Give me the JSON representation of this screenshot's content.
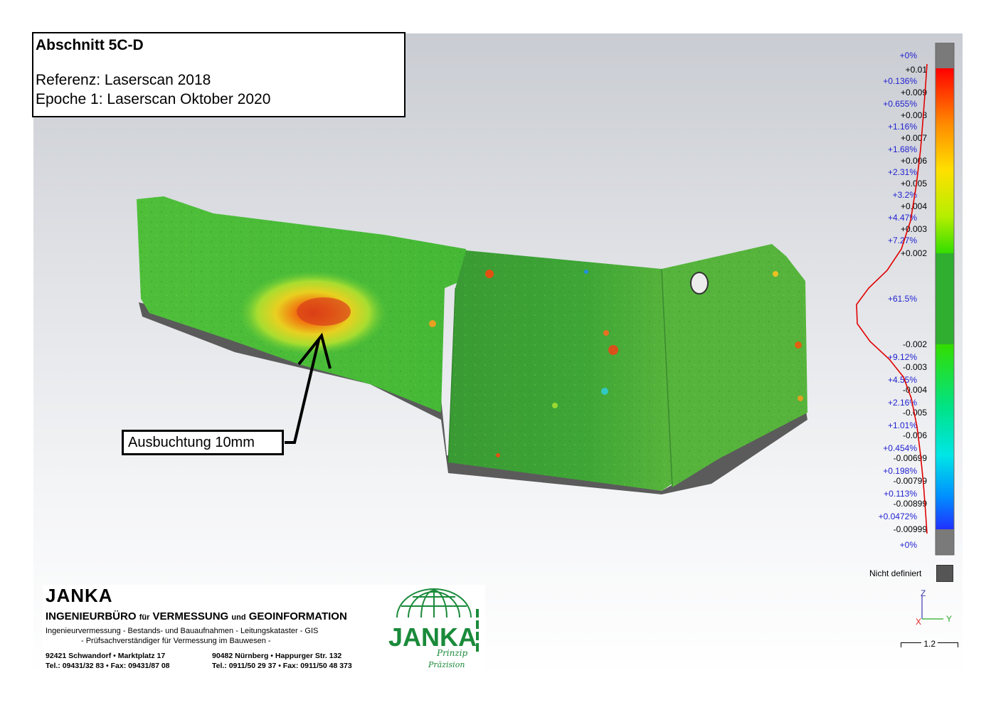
{
  "header": {
    "title": "Abschnitt 5C-D",
    "reference": "Referenz: Laserscan 2018",
    "epoch": "Epoche 1: Laserscan Oktober 2020"
  },
  "annotation": {
    "label": "Ausbuchtung 10mm"
  },
  "color_scale": {
    "entries": [
      {
        "pct": "+0%",
        "val": "+0.01"
      },
      {
        "pct": "+0.136%",
        "val": "+0.009"
      },
      {
        "pct": "+0.655%",
        "val": "+0.008"
      },
      {
        "pct": "+1.16%",
        "val": "+0.007"
      },
      {
        "pct": "+1.68%",
        "val": "+0.006"
      },
      {
        "pct": "+2.31%",
        "val": "+0.005"
      },
      {
        "pct": "+3.2%",
        "val": "+0.004"
      },
      {
        "pct": "+4.47%",
        "val": "+0.003"
      },
      {
        "pct": "+7.27%",
        "val": "+0.002"
      },
      {
        "pct": "+61.5%",
        "val": "-0.002"
      },
      {
        "pct": "+9.12%",
        "val": "-0.003"
      },
      {
        "pct": "+4.55%",
        "val": "-0.004"
      },
      {
        "pct": "+2.16%",
        "val": "-0.005"
      },
      {
        "pct": "+1.01%",
        "val": "-0.006"
      },
      {
        "pct": "+0.454%",
        "val": "-0.00699"
      },
      {
        "pct": "+0.198%",
        "val": "-0.00799"
      },
      {
        "pct": "+0.113%",
        "val": "-0.00899"
      },
      {
        "pct": "+0.0472%",
        "val": "-0.00999"
      },
      {
        "pct": "+0%",
        "val": ""
      }
    ],
    "colors": [
      "#ff0000",
      "#ff8a00",
      "#ffe000",
      "#b6ee00",
      "#33dd00",
      "#2fae2f",
      "#33dd00",
      "#00e38a",
      "#00e6e6",
      "#0090ff",
      "#2030ff"
    ],
    "undefined_label": "Nicht definiert",
    "undefined_color": "#555555"
  },
  "axes": {
    "z": "Z",
    "y": "Y",
    "x": "X",
    "scale": "1.2"
  },
  "company": {
    "name": "JANKA",
    "office_prefix": "INGENIEURBÜRO",
    "office_fuer": "für",
    "office_main": "VERMESSUNG",
    "office_und": "und",
    "office_end": "GEOINFORMATION",
    "services": "Ingenieurvermessung - Bestands- und Bauaufnahmen - Leitungskataster - GIS",
    "services2": "- Prüfsachverständiger für Vermessung im Bauwesen -",
    "addr1": "92421 Schwandorf  •  Marktplatz 17",
    "addr2": "90482 Nürnberg  •  Happurger Str. 132",
    "tel1": "Tel.: 09431/32 83  •   Fax:  09431/87 08",
    "tel2": "Tel.: 0911/50 29 37  •  Fax: 0911/50 48 373",
    "logo_text": "JANKA",
    "logo_sub1": "Prinzip",
    "logo_sub2": "Präzision",
    "brand_color": "#1a8a3a"
  }
}
